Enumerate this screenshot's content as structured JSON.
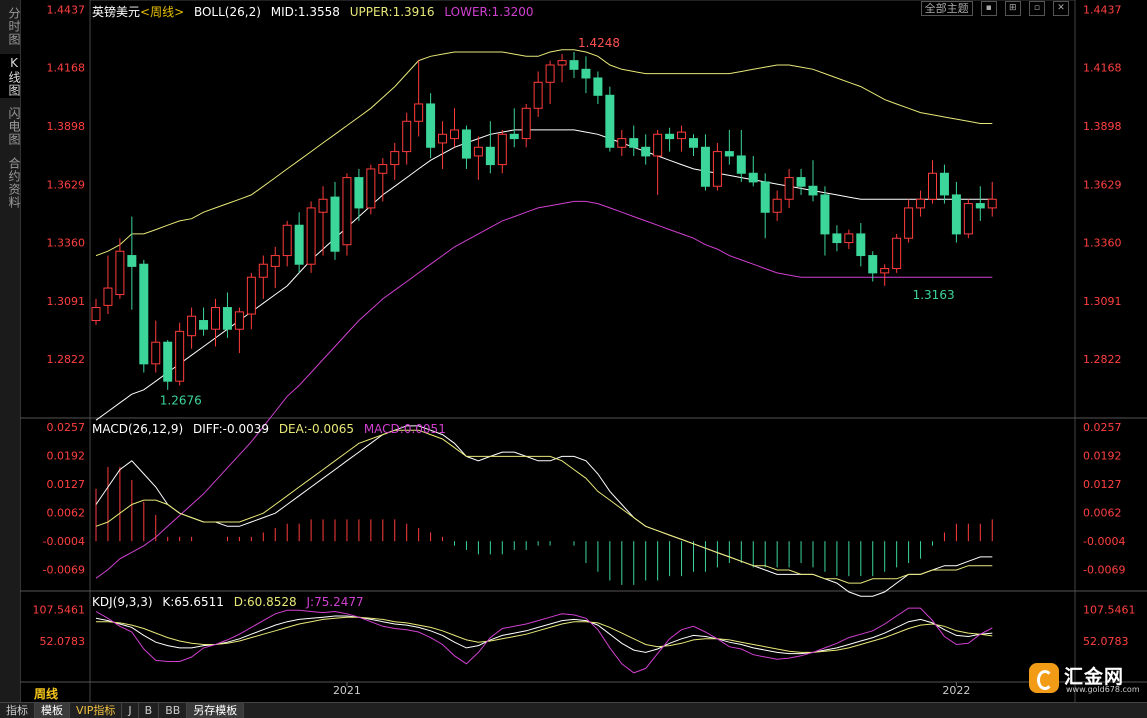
{
  "left_tabs": [
    "分时图",
    "K线图",
    "闪电图",
    "合约资料"
  ],
  "header": {
    "pair": "英镑美元",
    "period_tag": "<周线>",
    "boll": "BOLL(26,2)",
    "mid": "MID:1.3558",
    "upper": "UPPER:1.3916",
    "lower": "LOWER:1.3200"
  },
  "toolbar": {
    "theme": "全部主题",
    "buttons": [
      "▪",
      "⊞",
      "▫",
      "✕"
    ]
  },
  "macd_header": {
    "name": "MACD(26,12,9)",
    "diff": "DIFF:-0.0039",
    "dea": "DEA:-0.0065",
    "macd": "MACD:0.0051"
  },
  "kdj_header": {
    "name": "KDJ(9,3,3)",
    "k": "K:65.6511",
    "d": "D:60.8528",
    "j": "J:75.2477"
  },
  "period_label": "周线",
  "bottom_tabs": [
    "指标",
    "模板",
    "VIP指标",
    "J",
    "B",
    "BB",
    "另存模板"
  ],
  "logo": {
    "name": "汇金网",
    "url": "www.gold678.com"
  },
  "colors": {
    "up": "#ff3c3c",
    "down": "#3cd59a",
    "mid": "#ffffff",
    "upper": "#e8e878",
    "lower": "#d040d0",
    "axis": "#ff4040"
  },
  "chart_data": [
    {
      "type": "candlestick",
      "title": "英镑美元 周线",
      "yticks": [
        "1.4437",
        "1.4168",
        "1.3898",
        "1.3629",
        "1.3360",
        "1.3091",
        "1.2822"
      ],
      "ylim": [
        1.255,
        1.448
      ],
      "xticks": [
        {
          "index": 21,
          "label": "2021"
        },
        {
          "index": 72,
          "label": "2022"
        }
      ],
      "annotations": [
        {
          "index": 40,
          "price": 1.4248,
          "label": "1.4248",
          "color": "#ff5050"
        },
        {
          "index": 68,
          "price": 1.3163,
          "label": "1.3163",
          "color": "#3cd59a"
        },
        {
          "index": 5,
          "price": 1.2676,
          "label": "1.2676",
          "color": "#3cd59a"
        }
      ],
      "ohlc": [
        [
          1.3,
          1.31,
          1.298,
          1.306
        ],
        [
          1.307,
          1.33,
          1.303,
          1.315
        ],
        [
          1.312,
          1.338,
          1.31,
          1.332
        ],
        [
          1.33,
          1.348,
          1.305,
          1.325
        ],
        [
          1.326,
          1.328,
          1.276,
          1.28
        ],
        [
          1.28,
          1.3,
          1.276,
          1.29
        ],
        [
          1.29,
          1.291,
          1.268,
          1.272
        ],
        [
          1.272,
          1.299,
          1.27,
          1.295
        ],
        [
          1.293,
          1.306,
          1.287,
          1.302
        ],
        [
          1.3,
          1.306,
          1.293,
          1.296
        ],
        [
          1.296,
          1.31,
          1.288,
          1.306
        ],
        [
          1.306,
          1.313,
          1.292,
          1.296
        ],
        [
          1.296,
          1.306,
          1.285,
          1.304
        ],
        [
          1.303,
          1.322,
          1.296,
          1.32
        ],
        [
          1.32,
          1.33,
          1.31,
          1.326
        ],
        [
          1.325,
          1.334,
          1.315,
          1.33
        ],
        [
          1.33,
          1.346,
          1.325,
          1.344
        ],
        [
          1.344,
          1.35,
          1.322,
          1.326
        ],
        [
          1.326,
          1.355,
          1.322,
          1.352
        ],
        [
          1.35,
          1.362,
          1.33,
          1.356
        ],
        [
          1.357,
          1.364,
          1.328,
          1.332
        ],
        [
          1.335,
          1.368,
          1.33,
          1.366
        ],
        [
          1.366,
          1.37,
          1.346,
          1.352
        ],
        [
          1.352,
          1.372,
          1.349,
          1.37
        ],
        [
          1.368,
          1.375,
          1.355,
          1.372
        ],
        [
          1.372,
          1.382,
          1.365,
          1.378
        ],
        [
          1.378,
          1.396,
          1.372,
          1.392
        ],
        [
          1.392,
          1.42,
          1.385,
          1.4
        ],
        [
          1.4,
          1.405,
          1.375,
          1.38
        ],
        [
          1.382,
          1.392,
          1.37,
          1.386
        ],
        [
          1.384,
          1.398,
          1.38,
          1.388
        ],
        [
          1.388,
          1.39,
          1.37,
          1.375
        ],
        [
          1.376,
          1.385,
          1.365,
          1.38
        ],
        [
          1.38,
          1.392,
          1.368,
          1.372
        ],
        [
          1.372,
          1.388,
          1.368,
          1.386
        ],
        [
          1.386,
          1.398,
          1.38,
          1.384
        ],
        [
          1.384,
          1.4,
          1.38,
          1.398
        ],
        [
          1.398,
          1.415,
          1.394,
          1.41
        ],
        [
          1.41,
          1.42,
          1.4,
          1.418
        ],
        [
          1.418,
          1.423,
          1.41,
          1.42
        ],
        [
          1.42,
          1.424,
          1.412,
          1.416
        ],
        [
          1.416,
          1.422,
          1.405,
          1.412
        ],
        [
          1.412,
          1.415,
          1.4,
          1.404
        ],
        [
          1.404,
          1.408,
          1.378,
          1.38
        ],
        [
          1.38,
          1.388,
          1.376,
          1.384
        ],
        [
          1.384,
          1.39,
          1.376,
          1.38
        ],
        [
          1.38,
          1.386,
          1.372,
          1.376
        ],
        [
          1.376,
          1.388,
          1.358,
          1.386
        ],
        [
          1.386,
          1.389,
          1.378,
          1.384
        ],
        [
          1.384,
          1.39,
          1.378,
          1.387
        ],
        [
          1.384,
          1.386,
          1.376,
          1.38
        ],
        [
          1.38,
          1.386,
          1.36,
          1.362
        ],
        [
          1.362,
          1.382,
          1.36,
          1.378
        ],
        [
          1.378,
          1.388,
          1.372,
          1.376
        ],
        [
          1.376,
          1.388,
          1.364,
          1.368
        ],
        [
          1.368,
          1.376,
          1.362,
          1.364
        ],
        [
          1.364,
          1.368,
          1.338,
          1.35
        ],
        [
          1.35,
          1.36,
          1.346,
          1.356
        ],
        [
          1.356,
          1.37,
          1.352,
          1.366
        ],
        [
          1.366,
          1.37,
          1.358,
          1.362
        ],
        [
          1.362,
          1.374,
          1.355,
          1.358
        ],
        [
          1.358,
          1.362,
          1.33,
          1.34
        ],
        [
          1.34,
          1.344,
          1.332,
          1.336
        ],
        [
          1.336,
          1.342,
          1.333,
          1.34
        ],
        [
          1.34,
          1.345,
          1.325,
          1.33
        ],
        [
          1.33,
          1.332,
          1.318,
          1.322
        ],
        [
          1.322,
          1.326,
          1.316,
          1.324
        ],
        [
          1.324,
          1.34,
          1.322,
          1.338
        ],
        [
          1.338,
          1.356,
          1.336,
          1.352
        ],
        [
          1.352,
          1.36,
          1.348,
          1.356
        ],
        [
          1.356,
          1.374,
          1.354,
          1.368
        ],
        [
          1.368,
          1.372,
          1.354,
          1.358
        ],
        [
          1.358,
          1.364,
          1.336,
          1.34
        ],
        [
          1.34,
          1.356,
          1.338,
          1.354
        ],
        [
          1.354,
          1.362,
          1.346,
          1.352
        ],
        [
          1.352,
          1.364,
          1.348,
          1.356
        ]
      ],
      "boll_upper": [
        1.33,
        1.332,
        1.335,
        1.34,
        1.34,
        1.342,
        1.344,
        1.346,
        1.347,
        1.35,
        1.352,
        1.354,
        1.356,
        1.358,
        1.362,
        1.366,
        1.37,
        1.374,
        1.378,
        1.382,
        1.386,
        1.39,
        1.394,
        1.398,
        1.403,
        1.408,
        1.414,
        1.42,
        1.422,
        1.423,
        1.424,
        1.424,
        1.424,
        1.424,
        1.424,
        1.423,
        1.422,
        1.422,
        1.424,
        1.425,
        1.425,
        1.424,
        1.422,
        1.418,
        1.416,
        1.415,
        1.414,
        1.414,
        1.414,
        1.414,
        1.414,
        1.414,
        1.414,
        1.414,
        1.415,
        1.416,
        1.417,
        1.418,
        1.418,
        1.417,
        1.416,
        1.414,
        1.412,
        1.41,
        1.408,
        1.405,
        1.402,
        1.4,
        1.398,
        1.396,
        1.395,
        1.394,
        1.393,
        1.392,
        1.391,
        1.391
      ],
      "boll_mid": [
        1.254,
        1.258,
        1.262,
        1.266,
        1.268,
        1.272,
        1.276,
        1.28,
        1.284,
        1.288,
        1.292,
        1.296,
        1.3,
        1.304,
        1.308,
        1.312,
        1.316,
        1.322,
        1.328,
        1.333,
        1.338,
        1.343,
        1.348,
        1.353,
        1.358,
        1.362,
        1.366,
        1.37,
        1.374,
        1.377,
        1.38,
        1.382,
        1.384,
        1.386,
        1.387,
        1.388,
        1.388,
        1.388,
        1.388,
        1.388,
        1.388,
        1.387,
        1.386,
        1.384,
        1.382,
        1.38,
        1.378,
        1.376,
        1.374,
        1.372,
        1.37,
        1.369,
        1.368,
        1.367,
        1.366,
        1.365,
        1.364,
        1.363,
        1.362,
        1.361,
        1.36,
        1.359,
        1.358,
        1.357,
        1.356,
        1.356,
        1.356,
        1.356,
        1.356,
        1.356,
        1.356,
        1.356,
        1.356,
        1.356,
        1.356,
        1.356
      ],
      "boll_lower": [
        1.181,
        1.185,
        1.19,
        1.193,
        1.196,
        1.2,
        1.205,
        1.21,
        1.215,
        1.22,
        1.226,
        1.232,
        1.238,
        1.244,
        1.251,
        1.258,
        1.265,
        1.27,
        1.276,
        1.282,
        1.288,
        1.294,
        1.3,
        1.305,
        1.31,
        1.314,
        1.318,
        1.322,
        1.326,
        1.33,
        1.334,
        1.337,
        1.34,
        1.343,
        1.346,
        1.348,
        1.35,
        1.352,
        1.353,
        1.354,
        1.355,
        1.355,
        1.354,
        1.352,
        1.35,
        1.348,
        1.346,
        1.344,
        1.342,
        1.34,
        1.338,
        1.335,
        1.333,
        1.33,
        1.328,
        1.326,
        1.324,
        1.322,
        1.321,
        1.32,
        1.32,
        1.32,
        1.32,
        1.32,
        1.32,
        1.32,
        1.32,
        1.32,
        1.32,
        1.32,
        1.32,
        1.32,
        1.32,
        1.32,
        1.32,
        1.32
      ]
    },
    {
      "type": "bar_line",
      "title": "MACD(26,12,9)",
      "yticks": [
        "0.0257",
        "0.0192",
        "0.0127",
        "0.0062",
        "-0.0004",
        "-0.0069"
      ],
      "ylim": [
        -0.0118,
        0.0278
      ],
      "diff": [
        0.008,
        0.012,
        0.016,
        0.018,
        0.015,
        0.012,
        0.008,
        0.006,
        0.005,
        0.004,
        0.004,
        0.003,
        0.003,
        0.004,
        0.005,
        0.006,
        0.008,
        0.01,
        0.012,
        0.014,
        0.016,
        0.018,
        0.02,
        0.022,
        0.024,
        0.025,
        0.026,
        0.026,
        0.025,
        0.024,
        0.022,
        0.019,
        0.018,
        0.019,
        0.02,
        0.02,
        0.019,
        0.018,
        0.018,
        0.019,
        0.019,
        0.018,
        0.015,
        0.011,
        0.008,
        0.005,
        0.003,
        0.002,
        0.001,
        0.0,
        -0.001,
        -0.002,
        -0.003,
        -0.004,
        -0.005,
        -0.006,
        -0.007,
        -0.008,
        -0.008,
        -0.008,
        -0.008,
        -0.009,
        -0.01,
        -0.012,
        -0.013,
        -0.013,
        -0.012,
        -0.01,
        -0.008,
        -0.008,
        -0.007,
        -0.006,
        -0.006,
        -0.005,
        -0.004,
        -0.004
      ],
      "dea": [
        0.003,
        0.004,
        0.006,
        0.008,
        0.009,
        0.009,
        0.008,
        0.006,
        0.005,
        0.004,
        0.004,
        0.004,
        0.004,
        0.005,
        0.006,
        0.008,
        0.01,
        0.012,
        0.014,
        0.016,
        0.018,
        0.02,
        0.022,
        0.023,
        0.024,
        0.025,
        0.025,
        0.025,
        0.024,
        0.023,
        0.021,
        0.019,
        0.019,
        0.019,
        0.019,
        0.019,
        0.019,
        0.019,
        0.019,
        0.018,
        0.016,
        0.014,
        0.011,
        0.009,
        0.007,
        0.005,
        0.003,
        0.002,
        0.001,
        0.0,
        -0.001,
        -0.002,
        -0.003,
        -0.004,
        -0.005,
        -0.006,
        -0.006,
        -0.007,
        -0.007,
        -0.008,
        -0.008,
        -0.009,
        -0.009,
        -0.01,
        -0.01,
        -0.009,
        -0.009,
        -0.009,
        -0.008,
        -0.008,
        -0.007,
        -0.007,
        -0.007,
        -0.006,
        -0.006,
        -0.006
      ],
      "macd": [
        0.012,
        0.017,
        0.017,
        0.014,
        0.009,
        0.006,
        0.001,
        0.001,
        0.001,
        0.0,
        0.0,
        0.001,
        0.001,
        0.001,
        0.002,
        0.003,
        0.004,
        0.004,
        0.005,
        0.005,
        0.005,
        0.005,
        0.005,
        0.005,
        0.005,
        0.005,
        0.004,
        0.003,
        0.002,
        0.001,
        -0.001,
        -0.002,
        -0.003,
        -0.003,
        -0.003,
        -0.002,
        -0.002,
        -0.001,
        -0.001,
        0.0,
        -0.001,
        -0.005,
        -0.007,
        -0.009,
        -0.01,
        -0.01,
        -0.009,
        -0.009,
        -0.008,
        -0.008,
        -0.007,
        -0.007,
        -0.006,
        -0.005,
        -0.005,
        -0.006,
        -0.006,
        -0.006,
        -0.006,
        -0.005,
        -0.006,
        -0.007,
        -0.008,
        -0.008,
        -0.008,
        -0.008,
        -0.007,
        -0.006,
        -0.005,
        -0.004,
        -0.001,
        0.002,
        0.004,
        0.004,
        0.004,
        0.005
      ]
    },
    {
      "type": "line",
      "title": "KDJ(9,3,3)",
      "yticks": [
        "107.5461",
        "52.0783"
      ],
      "ylim": [
        -20,
        140
      ],
      "k": [
        92,
        88,
        82,
        76,
        62,
        50,
        44,
        40,
        40,
        44,
        46,
        50,
        56,
        64,
        72,
        80,
        86,
        90,
        92,
        94,
        96,
        96,
        94,
        90,
        86,
        82,
        80,
        76,
        70,
        62,
        50,
        40,
        44,
        54,
        62,
        66,
        70,
        76,
        82,
        88,
        90,
        88,
        80,
        64,
        48,
        36,
        32,
        38,
        48,
        56,
        62,
        60,
        56,
        50,
        46,
        40,
        36,
        32,
        30,
        30,
        32,
        36,
        40,
        46,
        52,
        58,
        66,
        76,
        86,
        90,
        84,
        72,
        62,
        60,
        64,
        66
      ],
      "d": [
        86,
        86,
        84,
        80,
        74,
        66,
        58,
        52,
        48,
        46,
        46,
        48,
        52,
        58,
        64,
        70,
        76,
        82,
        86,
        90,
        92,
        94,
        94,
        92,
        90,
        86,
        84,
        80,
        76,
        70,
        62,
        54,
        50,
        52,
        56,
        60,
        64,
        70,
        76,
        82,
        86,
        86,
        84,
        76,
        66,
        56,
        46,
        42,
        44,
        48,
        54,
        56,
        56,
        54,
        50,
        46,
        42,
        38,
        34,
        32,
        32,
        34,
        36,
        40,
        46,
        52,
        58,
        66,
        74,
        80,
        82,
        78,
        70,
        66,
        64,
        61
      ],
      "j": [
        104,
        92,
        78,
        68,
        38,
        18,
        16,
        16,
        24,
        40,
        46,
        54,
        64,
        76,
        88,
        100,
        106,
        106,
        104,
        102,
        104,
        100,
        94,
        86,
        78,
        74,
        72,
        68,
        58,
        46,
        26,
        12,
        32,
        58,
        74,
        78,
        82,
        88,
        94,
        100,
        98,
        92,
        72,
        40,
        12,
        -4,
        4,
        30,
        56,
        72,
        78,
        68,
        56,
        42,
        38,
        28,
        24,
        20,
        22,
        26,
        32,
        40,
        48,
        58,
        64,
        70,
        82,
        96,
        110,
        110,
        88,
        60,
        46,
        48,
        64,
        75
      ]
    }
  ]
}
